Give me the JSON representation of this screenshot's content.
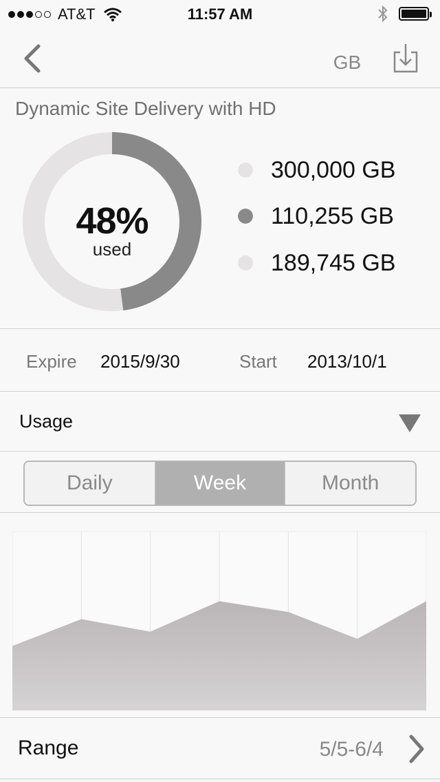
{
  "status_bar": {
    "carrier": "AT&T",
    "signal_bars_filled": 3,
    "signal_bars_total": 5,
    "time": "11:57 AM",
    "icons": [
      "wifi-icon",
      "bluetooth-icon",
      "battery-icon"
    ]
  },
  "nav": {
    "back_icon": "chevron-left-icon",
    "unit_label": "GB",
    "download_icon": "download-icon"
  },
  "plan": {
    "title": "Dynamic Site Delivery with HD",
    "percent_label": "48%",
    "used_label": "used",
    "used_fraction": 0.48,
    "legend": [
      {
        "value": "300,000 GB",
        "icon": "total-dot"
      },
      {
        "value": "110,255 GB",
        "icon": "used-dot"
      },
      {
        "value": "189,745 GB",
        "icon": "remaining-dot"
      }
    ]
  },
  "dates": {
    "expire_label": "Expire",
    "expire_value": "2015/9/30",
    "start_label": "Start",
    "start_value": "2013/10/1"
  },
  "usage": {
    "label": "Usage",
    "dropdown_icon": "triangle-down-icon"
  },
  "period_tabs": {
    "items": [
      "Daily",
      "Week",
      "Month"
    ],
    "selected": "Week"
  },
  "chart_data": {
    "type": "area",
    "x": [
      0,
      1,
      2,
      3,
      4,
      5,
      6
    ],
    "values": [
      0.36,
      0.51,
      0.44,
      0.61,
      0.55,
      0.4,
      0.61
    ],
    "ylim": [
      0,
      1
    ],
    "grid": true,
    "xlabel": "",
    "ylabel": "",
    "title": ""
  },
  "range": {
    "label": "Range",
    "value": "5/5-6/4",
    "chevron_icon": "chevron-right-icon"
  },
  "colors": {
    "used": "#898989",
    "remaining": "#e5e3e4",
    "area_top": "#bab5b6",
    "area_bottom": "#d6d3d4",
    "accent_gray": "#b0b0b0"
  }
}
